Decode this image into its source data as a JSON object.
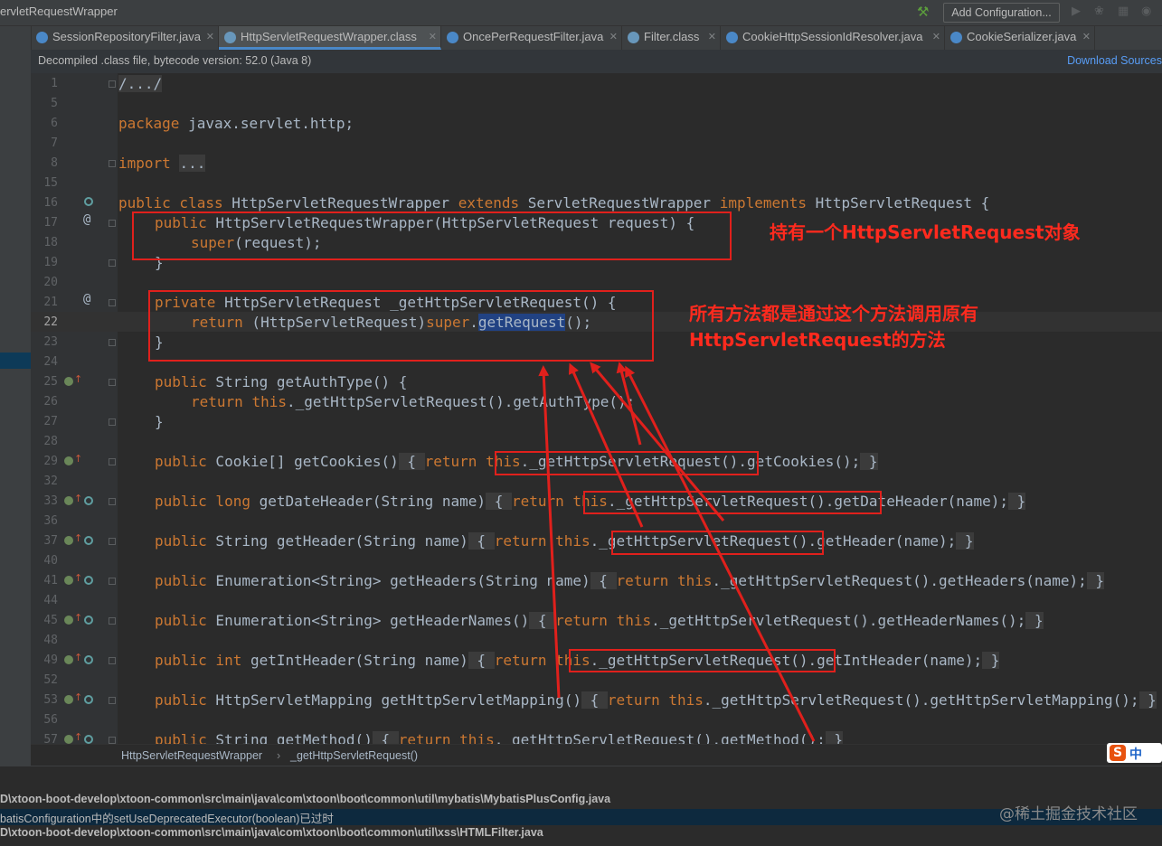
{
  "window": {
    "title": "ervletRequestWrapper",
    "add_configuration": "Add Configuration..."
  },
  "toolbar_icons": [
    "hammer-icon",
    "run-icon",
    "debug-icon",
    "coverage-icon",
    "profile-icon"
  ],
  "tabs": [
    {
      "label": "SessionRepositoryFilter.java",
      "icon_color": "#4a88c7"
    },
    {
      "label": "HttpServletRequestWrapper.class",
      "icon_color": "#6897bb",
      "active": true
    },
    {
      "label": "OncePerRequestFilter.java",
      "icon_color": "#4a88c7"
    },
    {
      "label": "Filter.class",
      "icon_color": "#6897bb"
    },
    {
      "label": "CookieHttpSessionIdResolver.java",
      "icon_color": "#4a88c7"
    },
    {
      "label": "CookieSerializer.java",
      "icon_color": "#4a88c7"
    }
  ],
  "banner": {
    "message": "Decompiled .class file, bytecode version: 52.0 (Java 8)",
    "action": "Download Sources"
  },
  "line_numbers": [
    "1",
    "5",
    "6",
    "7",
    "8",
    "15",
    "16",
    "17",
    "18",
    "19",
    "20",
    "21",
    "22",
    "23",
    "24",
    "25",
    "26",
    "27",
    "28",
    "29",
    "32",
    "33",
    "36",
    "37",
    "40",
    "41",
    "44",
    "45",
    "48",
    "49",
    "52",
    "53",
    "56",
    "57"
  ],
  "code": {
    "l1": "/.../",
    "l6_kw": "package",
    "l6": " javax.servlet.http;",
    "l8_kw": "import",
    "l8": "...",
    "l16_a": "public class",
    "l16_b": " HttpServletRequestWrapper ",
    "l16_c": "extends",
    "l16_d": " ServletRequestWrapper ",
    "l16_e": "implements",
    "l16_f": " HttpServletRequest {",
    "l17_a": "public",
    "l17_b": " HttpServletRequestWrapper(HttpServletRequest request) {",
    "l18_a": "super",
    "l18_b": "(request);",
    "l19": "}",
    "l21_a": "private",
    "l21_b": " HttpServletRequest _getHttpServletRequest() {",
    "l22_a": "return",
    "l22_b": " (HttpServletRequest)",
    "l22_c": "super",
    "l22_d": ".",
    "l22_e": "getRequest",
    "l22_f": "();",
    "l23": "}",
    "l25_a": "public",
    "l25_b": " String getAuthType() {",
    "l26_a": "return",
    "l26_b": " ",
    "l26_c": "this",
    "l26_d": "._getHttpServletRequest().getAuthType();",
    "l27": "}",
    "l29_a": "public",
    "l29_b": " Cookie[] getCookies()",
    "l29_c": " { ",
    "l29_d": "return",
    "l29_e": " ",
    "l29_f": "this",
    "l29_g": "._getHttpServletRequest().getCookies();",
    "l29_h": " }",
    "l33_a": "public long",
    "l33_b": " getDateHeader(String name)",
    "l33_c": " { ",
    "l33_d": "return",
    "l33_e": " ",
    "l33_f": "this",
    "l33_g": "._getHttpServletRequest().getDateHeader(name);",
    "l33_h": " }",
    "l37_a": "public",
    "l37_b": " String getHeader(String name)",
    "l37_c": " { ",
    "l37_d": "return",
    "l37_e": " ",
    "l37_f": "this",
    "l37_g": "._getHttpServletRequest().getHeader(name);",
    "l37_h": " }",
    "l41_a": "public",
    "l41_b": " Enumeration<String> getHeaders(String name)",
    "l41_c": " { ",
    "l41_d": "return",
    "l41_e": " ",
    "l41_f": "this",
    "l41_g": "._getHttpServletRequest().getHeaders(name);",
    "l41_h": " }",
    "l45_a": "public",
    "l45_b": " Enumeration<String> getHeaderNames()",
    "l45_c": " { ",
    "l45_d": "return",
    "l45_e": " ",
    "l45_f": "this",
    "l45_g": "._getHttpServletRequest().getHeaderNames();",
    "l45_h": " }",
    "l49_a": "public int",
    "l49_b": " getIntHeader(String name)",
    "l49_c": " { ",
    "l49_d": "return",
    "l49_e": " ",
    "l49_f": "this",
    "l49_g": "._getHttpServletRequest().getIntHeader(name);",
    "l49_h": " }",
    "l53_a": "public",
    "l53_b": " HttpServletMapping getHttpServletMapping()",
    "l53_c": " { ",
    "l53_d": "return",
    "l53_e": " ",
    "l53_f": "this",
    "l53_g": "._getHttpServletRequest().getHttpServletMapping();",
    "l53_h": " }",
    "l57_a": "public",
    "l57_b": " String getMethod()",
    "l57_c": " { ",
    "l57_d": "return",
    "l57_e": " ",
    "l57_f": "this",
    "l57_g": "._getHttpServletRequest().getMethod();",
    "l57_h": " }"
  },
  "annotations": {
    "a1": "持有一个HttpServletRequest对象",
    "a2_line1": "所有方法都是通过这个方法调用原有",
    "a2_line2": "HttpServletRequest的方法"
  },
  "annotation_color": "#e0201c",
  "breadcrumb": [
    "HttpServletRequestWrapper",
    "_getHttpServletRequest()"
  ],
  "bottom_panel": {
    "line1": "D\\xtoon-boot-develop\\xtoon-common\\src\\main\\java\\com\\xtoon\\boot\\common\\util\\mybatis\\MybatisPlusConfig.java",
    "line2": "batisConfiguration中的setUseDeprecatedExecutor(boolean)已过时",
    "line3": "D\\xtoon-boot-develop\\xtoon-common\\src\\main\\java\\com\\xtoon\\boot\\common\\util\\xss\\HTMLFilter.java"
  },
  "watermark": "@稀土掘金技术社区",
  "ime": {
    "logo": "S",
    "mode": "中"
  }
}
